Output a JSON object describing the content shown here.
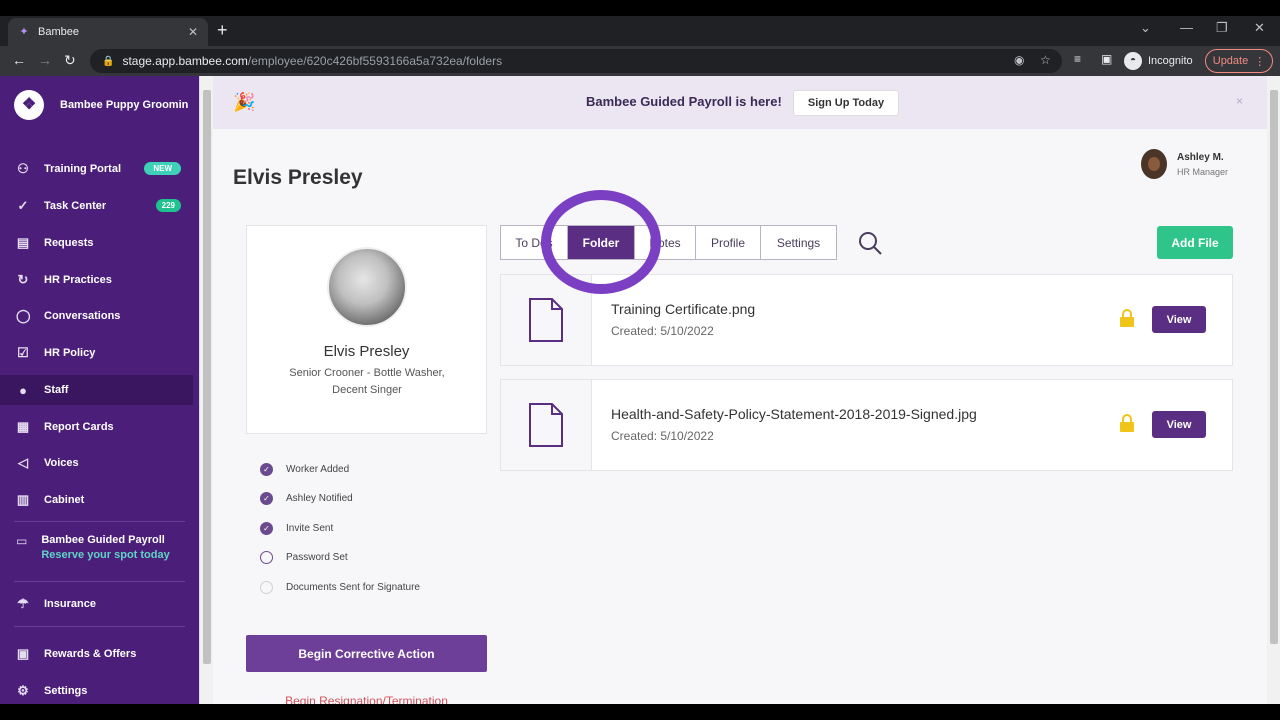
{
  "browser": {
    "tab_title": "Bambee",
    "url_host": "stage.app.bambee.com",
    "url_path": "/employee/620c426bf5593166a5a732ea/folders",
    "profile_label": "Incognito",
    "update_label": "Update"
  },
  "sidebar": {
    "brand": "Bambee Puppy Grooming",
    "items": [
      {
        "label": "Training Portal",
        "icon": "training-icon",
        "badge": "NEW"
      },
      {
        "label": "Task Center",
        "icon": "check-circle-icon",
        "badge": "229"
      },
      {
        "label": "Requests",
        "icon": "requests-icon"
      },
      {
        "label": "HR Practices",
        "icon": "refresh-icon"
      },
      {
        "label": "Conversations",
        "icon": "chat-icon"
      },
      {
        "label": "HR Policy",
        "icon": "clipboard-icon"
      },
      {
        "label": "Staff",
        "icon": "person-icon",
        "active": true
      },
      {
        "label": "Report Cards",
        "icon": "report-icon"
      },
      {
        "label": "Voices",
        "icon": "megaphone-icon"
      },
      {
        "label": "Cabinet",
        "icon": "cabinet-icon"
      },
      {
        "label": "Insurance",
        "icon": "umbrella-icon"
      },
      {
        "label": "Rewards & Offers",
        "icon": "gift-icon"
      },
      {
        "label": "Settings",
        "icon": "gear-icon"
      }
    ],
    "payroll": {
      "title": "Bambee Guided Payroll",
      "cta": "Reserve your spot today"
    }
  },
  "banner": {
    "message": "Bambee Guided Payroll is here!",
    "button": "Sign Up Today",
    "close": "×"
  },
  "employee": {
    "name": "Elvis Presley",
    "card_name": "Elvis Presley",
    "title": "Senior Crooner - Bottle Washer, Decent Singer"
  },
  "user": {
    "name": "Ashley M.",
    "role": "HR Manager"
  },
  "checklist": [
    {
      "label": "Worker Added",
      "state": "done"
    },
    {
      "label": "Ashley Notified",
      "state": "done"
    },
    {
      "label": "Invite Sent",
      "state": "done"
    },
    {
      "label": "Password Set",
      "state": "pending"
    },
    {
      "label": "Documents Sent for Signature",
      "state": "pending-faint"
    }
  ],
  "actions": {
    "corrective": "Begin Corrective Action",
    "resign": "Begin Resignation/Termination"
  },
  "tabs": [
    {
      "label": "To Dos"
    },
    {
      "label": "Folder",
      "active": true
    },
    {
      "label": "Notes"
    },
    {
      "label": "Profile"
    },
    {
      "label": "Settings"
    }
  ],
  "add_file": "Add File",
  "files": [
    {
      "name": "Training Certificate.png",
      "created": "Created: 5/10/2022",
      "view": "View"
    },
    {
      "name": "Health-and-Safety-Policy-Statement-2018-2019-Signed.jpg",
      "created": "Created: 5/10/2022",
      "view": "View"
    }
  ],
  "colors": {
    "brand_purple": "#4b1e7a",
    "accent_green": "#2fc58a",
    "highlight_ring": "#7b3fc4",
    "lock_yellow": "#f0c419"
  }
}
